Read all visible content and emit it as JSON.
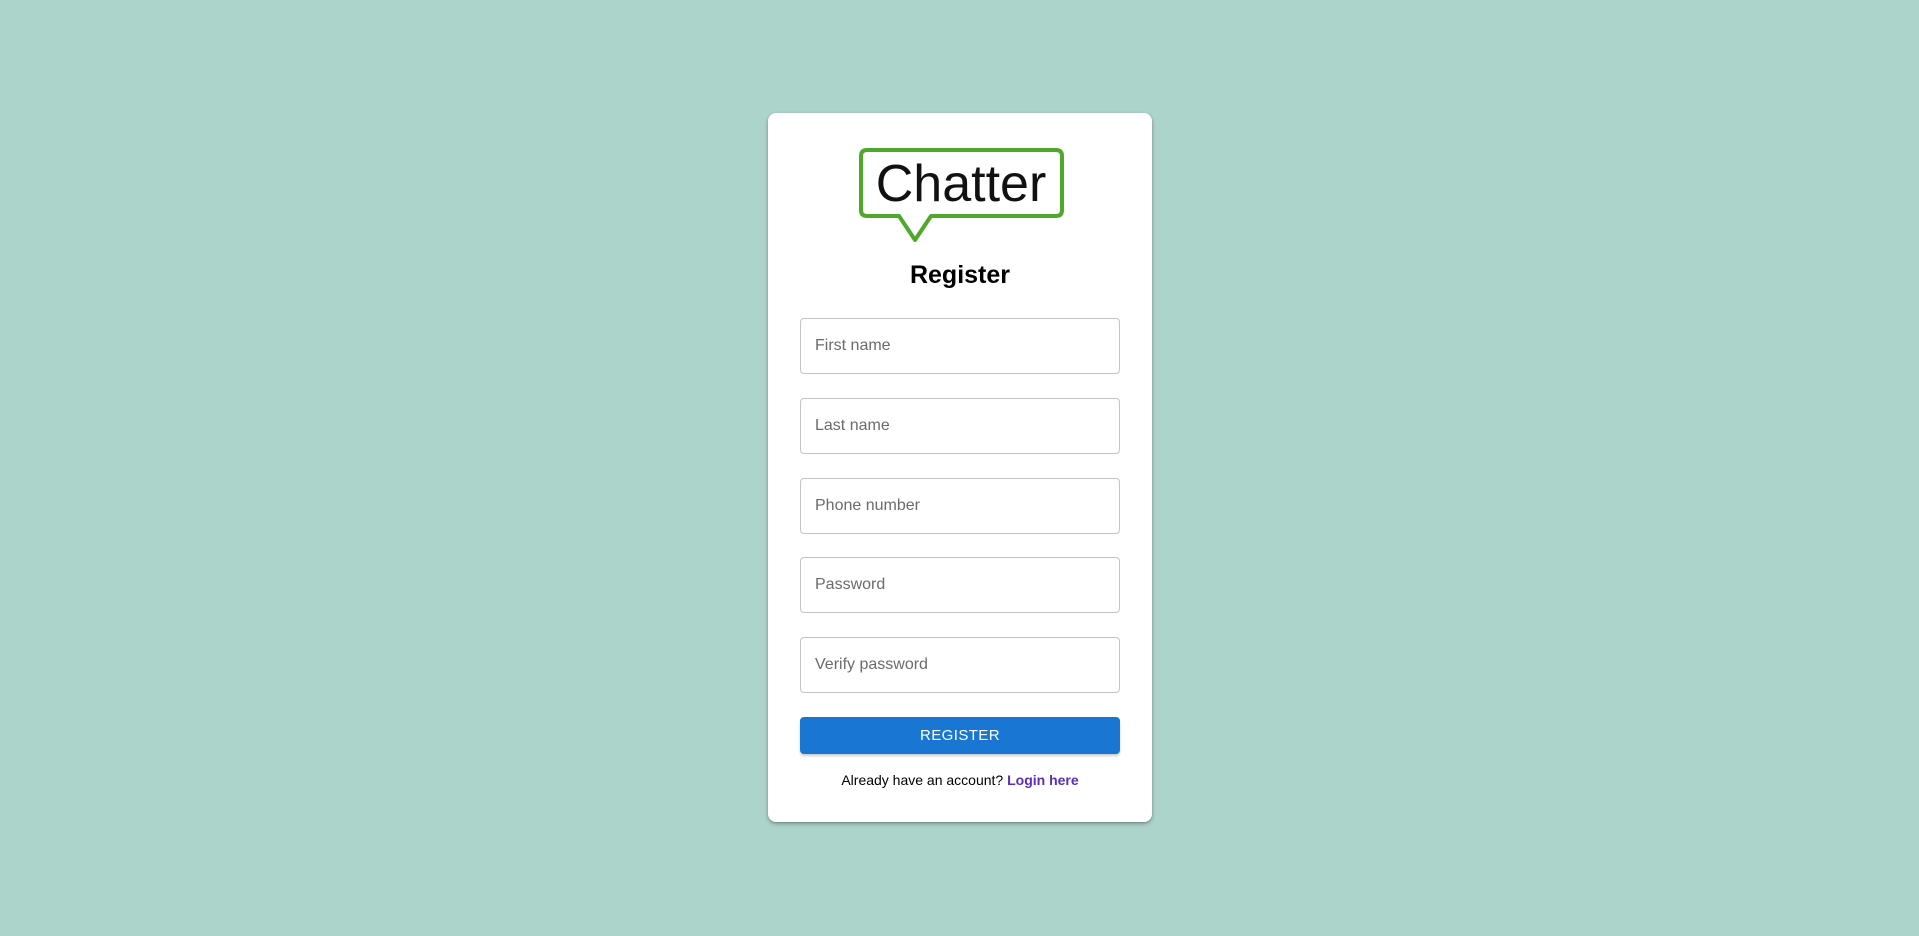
{
  "logo": {
    "text": "Chatter",
    "border_color": "#4ea82a"
  },
  "form": {
    "title": "Register",
    "fields": [
      {
        "placeholder": "First name",
        "value": ""
      },
      {
        "placeholder": "Last name",
        "value": ""
      },
      {
        "placeholder": "Phone number",
        "value": ""
      },
      {
        "placeholder": "Password",
        "value": ""
      },
      {
        "placeholder": "Verify password",
        "value": ""
      }
    ],
    "submit_label": "REGISTER",
    "footer_text": "Already have an account?",
    "login_link": "Login here"
  },
  "colors": {
    "background": "#acd4ca",
    "button": "#1976d2",
    "link": "#5b2db8"
  }
}
